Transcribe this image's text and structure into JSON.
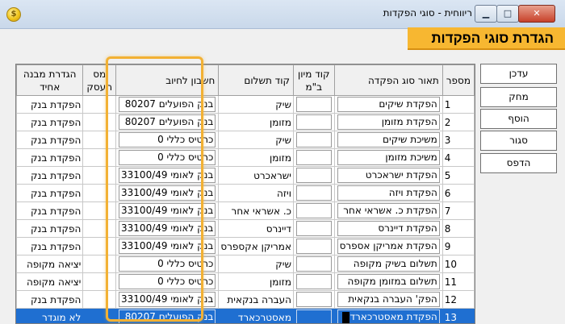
{
  "window": {
    "title": "ריווחית - סוגי הפקדות",
    "app_icon": "$",
    "minimize_glyph": "▁",
    "maximize_glyph": "□",
    "close_glyph": "✕"
  },
  "banner": {
    "title": "הגדרת סוגי הפקדות"
  },
  "columns": [
    "מספר",
    "תאור סוג הפקדה",
    "קוד מיון ב\"מ",
    "קוד תשלום",
    "חשבון לחיוב",
    "מס העסק",
    "הגדרת מבנה אחיד"
  ],
  "rows": [
    {
      "num": "1",
      "desc": "הפקדת שיקים",
      "sort": "",
      "pay": "שיק",
      "account": "בנק הפועלים 80207",
      "tax": "",
      "structure": "הפקדת בנק"
    },
    {
      "num": "2",
      "desc": "הפקדת מזומן",
      "sort": "",
      "pay": "מזומן",
      "account": "בנק הפועלים 80207",
      "tax": "",
      "structure": "הפקדת בנק"
    },
    {
      "num": "3",
      "desc": "משיכת שיקים",
      "sort": "",
      "pay": "שיק",
      "account": "כרטיס כללי 0",
      "tax": "",
      "structure": "הפקדת בנק"
    },
    {
      "num": "4",
      "desc": "משיכת מזומן",
      "sort": "",
      "pay": "מזומן",
      "account": "כרטיס כללי 0",
      "tax": "",
      "structure": "הפקדת בנק"
    },
    {
      "num": "5",
      "desc": "הפקדת ישראכרט",
      "sort": "",
      "pay": "ישראכרט",
      "account": "בנק לאומי 33100/49",
      "tax": "",
      "structure": "הפקדת בנק"
    },
    {
      "num": "6",
      "desc": "הפקדת ויזה",
      "sort": "",
      "pay": "ויזה",
      "account": "בנק לאומי 33100/49",
      "tax": "",
      "structure": "הפקדת בנק"
    },
    {
      "num": "7",
      "desc": "הפקדת כ. אשראי אחר",
      "sort": "",
      "pay": "כ. אשראי אחר",
      "account": "בנק לאומי 33100/49",
      "tax": "",
      "structure": "הפקדת בנק"
    },
    {
      "num": "8",
      "desc": "הפקדת דיינרס",
      "sort": "",
      "pay": "דיינרס",
      "account": "בנק לאומי 33100/49",
      "tax": "",
      "structure": "הפקדת בנק"
    },
    {
      "num": "9",
      "desc": "הפקדת אמריקן אספרס",
      "sort": "",
      "pay": "אמריקן אקספרס",
      "account": "בנק לאומי 33100/49",
      "tax": "",
      "structure": "הפקדת בנק"
    },
    {
      "num": "10",
      "desc": "תשלום בשיק מקופה",
      "sort": "",
      "pay": "שיק",
      "account": "כרטיס כללי 0",
      "tax": "",
      "structure": "יציאה מקופה"
    },
    {
      "num": "11",
      "desc": "תשלום במזומן מקופה",
      "sort": "",
      "pay": "מזומן",
      "account": "כרטיס כללי 0",
      "tax": "",
      "structure": "יציאה מקופה"
    },
    {
      "num": "12",
      "desc": "הפק' העברה בנקאית",
      "sort": "",
      "pay": "העברה בנקאית",
      "account": "בנק לאומי 33100/49",
      "tax": "",
      "structure": "הפקדת בנק"
    },
    {
      "num": "13",
      "desc": "הפקדת מאסטרכארד",
      "sort": "",
      "pay": "מאסטרכארד",
      "account": "בנק הפועלים 80207",
      "tax": "",
      "structure": "לא מוגדר"
    }
  ],
  "buttons": {
    "update": "עדכן",
    "delete": "מחק",
    "add": "הוסף",
    "close": "סגור",
    "print": "הדפס"
  }
}
